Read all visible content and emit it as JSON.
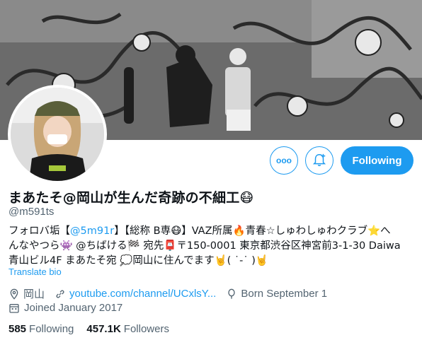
{
  "profile": {
    "display_name": "まあたそ@岡山が生んだ奇跡の不細工😷",
    "handle": "@m591ts",
    "bio": {
      "line1_a": "フォロバ垢【",
      "line1_mention": "@5m91r",
      "line1_b": "】【総称 B専😷】VAZ所属🔥青春☆しゅわしゅわクラブ⭐へ",
      "line2": "んなやつら👾 @ちばける🏁 宛先📮〒150-0001 東京都渋谷区神宮前3-1-30 Daiwa",
      "line3": "青山ビル4F まあたそ宛 💭岡山に住んでます🤘( ˙-˙ )🤘"
    },
    "translate_label": "Translate bio",
    "location": "岡山",
    "website": "youtube.com/channel/UCxlsY...",
    "birthday": "Born September 1",
    "joined": "Joined January 2017",
    "following_count": "585",
    "following_label": "Following",
    "followers_count": "457.1K",
    "followers_label": "Followers"
  },
  "actions": {
    "more_label": "ooo",
    "follow_label": "Following"
  },
  "colors": {
    "accent": "#1d9bf0",
    "muted": "#536471",
    "text": "#0f1419"
  }
}
